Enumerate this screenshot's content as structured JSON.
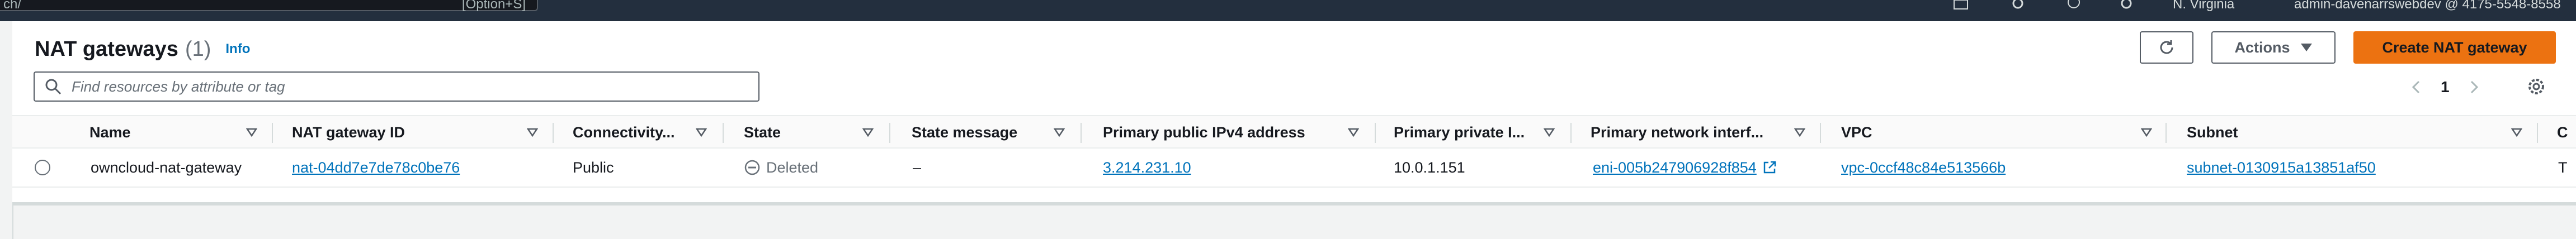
{
  "topbar": {
    "search_text": "ch/",
    "search_hint": "[Option+S]",
    "region": "N. Virginia",
    "account": "admin-davenarrswebdev @ 4175-5548-8558"
  },
  "header": {
    "title": "NAT gateways",
    "count": "(1)",
    "info": "Info"
  },
  "toolbar": {
    "actions_label": "Actions",
    "create_label": "Create NAT gateway"
  },
  "search": {
    "placeholder": "Find resources by attribute or tag"
  },
  "pagination": {
    "page": "1"
  },
  "table": {
    "columns": [
      "Name",
      "NAT gateway ID",
      "Connectivity...",
      "State",
      "State message",
      "Primary public IPv4 address",
      "Primary private I...",
      "Primary network interf...",
      "VPC",
      "Subnet",
      "C"
    ],
    "rows": [
      {
        "name": "owncloud-nat-gateway",
        "nat_id": "nat-04dd7e7de78c0be76",
        "connectivity": "Public",
        "state": "Deleted",
        "state_message": "–",
        "public_ip": "3.214.231.10",
        "private_ip": "10.0.1.151",
        "eni": "eni-005b247906928f854",
        "vpc": "vpc-0ccf48c84e513566b",
        "subnet": "subnet-0130915a13851af50",
        "extra": "T"
      }
    ]
  },
  "colors": {
    "topbar": "#232f3e",
    "link": "#0073bb",
    "primary_button": "#ec7211"
  }
}
